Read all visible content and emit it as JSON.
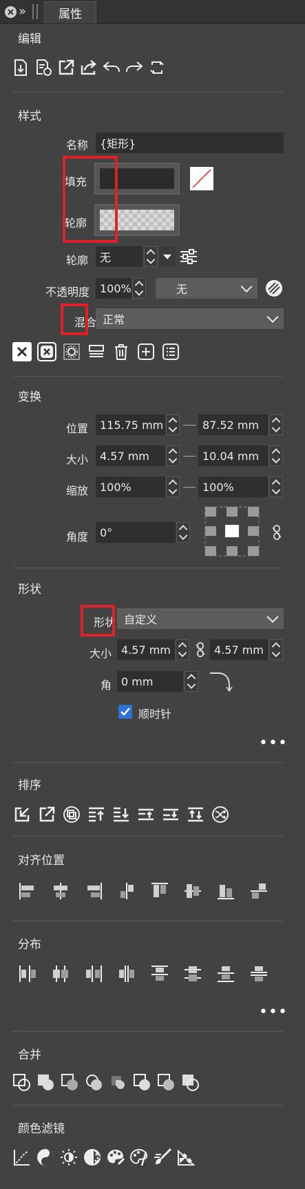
{
  "panel": {
    "tab_label": "属性"
  },
  "sections": {
    "edit": "编辑",
    "style": "样式",
    "transform": "变换",
    "shape": "形状",
    "order": "排序",
    "align": "对齐位置",
    "distribute": "分布",
    "merge": "合并",
    "color_filter": "颜色滤镜"
  },
  "style": {
    "name_label": "名称",
    "name_value": "{矩形}",
    "fill_label": "填充",
    "outline_label": "轮廓",
    "outline_type_label": "轮廓",
    "outline_type_value": "无",
    "opacity_label": "不透明度",
    "opacity_value": "100%",
    "opacity_mode_value": "无",
    "blend_label": "混合",
    "blend_value": "正常"
  },
  "transform": {
    "position_label": "位置",
    "position_x": "115.75 mm",
    "position_y": "87.52 mm",
    "size_label": "大小",
    "size_w": "4.57 mm",
    "size_h": "10.04 mm",
    "scale_label": "缩放",
    "scale_x": "100%",
    "scale_y": "100%",
    "angle_label": "角度",
    "angle_value": "0°"
  },
  "shape": {
    "shape_label": "形状",
    "shape_value": "自定义",
    "size_label": "大小",
    "size_w": "4.57 mm",
    "size_h": "4.57 mm",
    "corner_label": "角",
    "corner_value": "0 mm",
    "clockwise_label": "顺时针",
    "clockwise_checked": true
  },
  "more": "•••",
  "icons": {
    "edit": [
      "import-icon",
      "edit-doc-icon",
      "open-external-icon",
      "share-icon",
      "undo-icon",
      "redo-icon",
      "refresh-icon"
    ],
    "style": [
      "remove-fill-icon",
      "remove-outline-icon",
      "gear-icon",
      "copy-style-icon",
      "trash-icon",
      "add-icon",
      "list-icon"
    ],
    "order": [
      "move-in-icon",
      "move-out-icon",
      "group-icon",
      "bring-to-front-icon",
      "send-to-back-icon",
      "bring-forward-icon",
      "send-backward-icon",
      "swap-icon",
      "shuffle-icon"
    ],
    "align": [
      "align-left-icon",
      "align-center-h-icon",
      "align-right-icon",
      "align-left-edge-icon",
      "align-top-icon",
      "align-center-v-icon",
      "align-bottom-icon",
      "align-bottom-edge-icon"
    ],
    "distribute": [
      "distribute-left-icon",
      "distribute-center-h-icon",
      "distribute-right-icon",
      "distribute-gap-h-icon",
      "distribute-top-icon",
      "distribute-center-v-icon",
      "distribute-bottom-icon",
      "distribute-gap-v-icon"
    ],
    "merge": [
      "merge-union-icon",
      "merge-subtract-front-icon",
      "merge-intersect-icon",
      "merge-exclude-icon",
      "merge-divide-icon",
      "merge-trim-icon",
      "merge-crop-icon",
      "merge-outline-icon"
    ],
    "color_filter": [
      "curves-icon",
      "yin-yang-icon",
      "brightness-icon",
      "halftone-icon",
      "palette-icon",
      "color-balance-icon",
      "brush-icon",
      "swatches-icon"
    ]
  }
}
